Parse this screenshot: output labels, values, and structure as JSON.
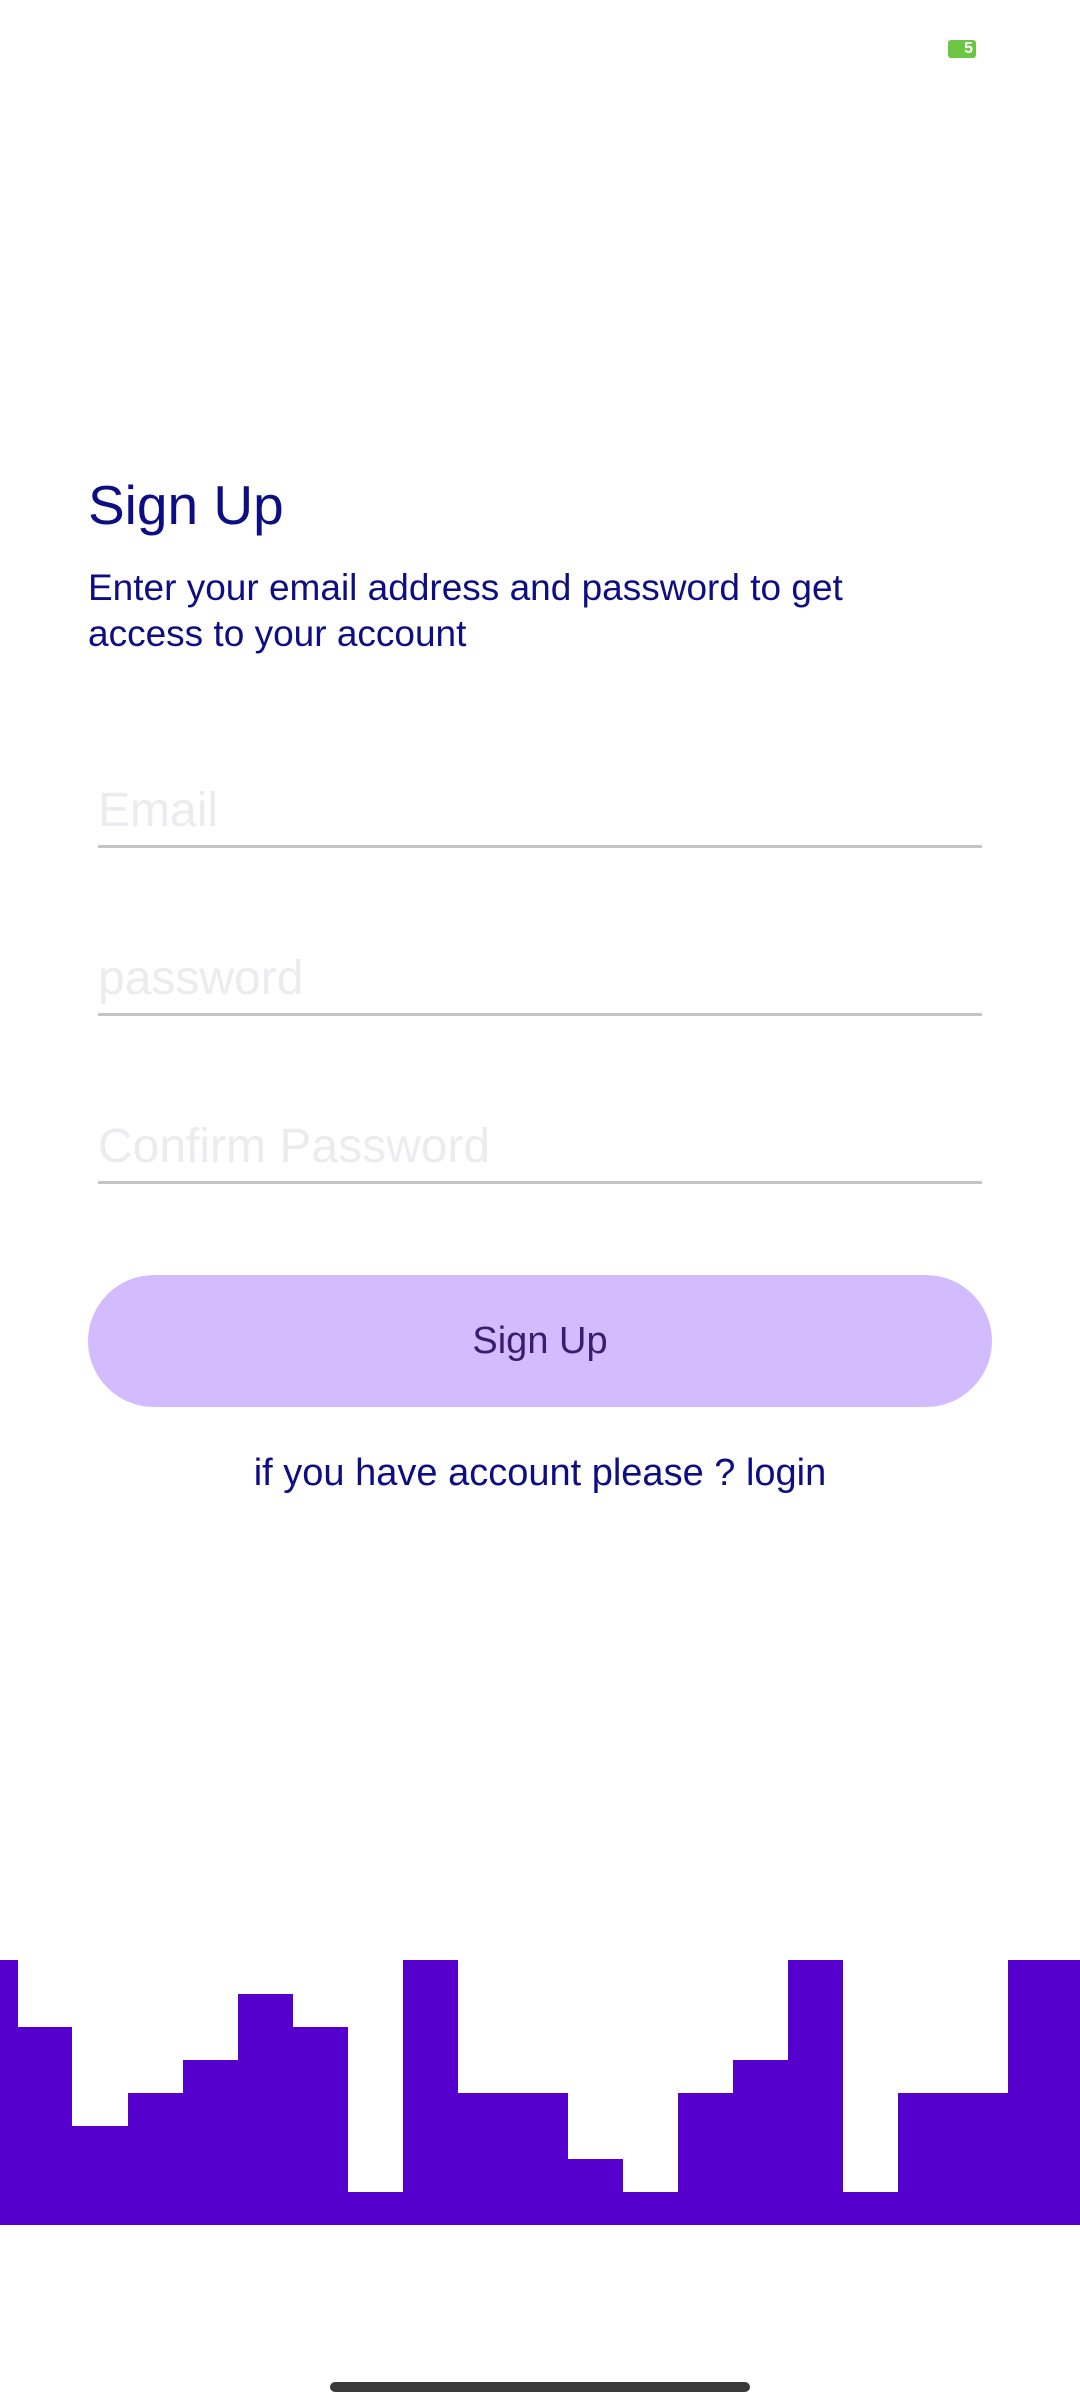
{
  "status_bar": {
    "battery_level": "5",
    "battery_color": "#6cc644"
  },
  "signup": {
    "title": "Sign Up",
    "subtitle": "Enter your email address and password to get access to your account",
    "email_placeholder": "Email",
    "password_placeholder": "password",
    "confirm_placeholder": "Confirm Password",
    "button_label": "Sign Up",
    "login_prompt": "if you have account please ? login"
  },
  "colors": {
    "primary_text": "#0d0d84",
    "button_bg": "#d2bcff",
    "skyline": "#5500cc"
  }
}
